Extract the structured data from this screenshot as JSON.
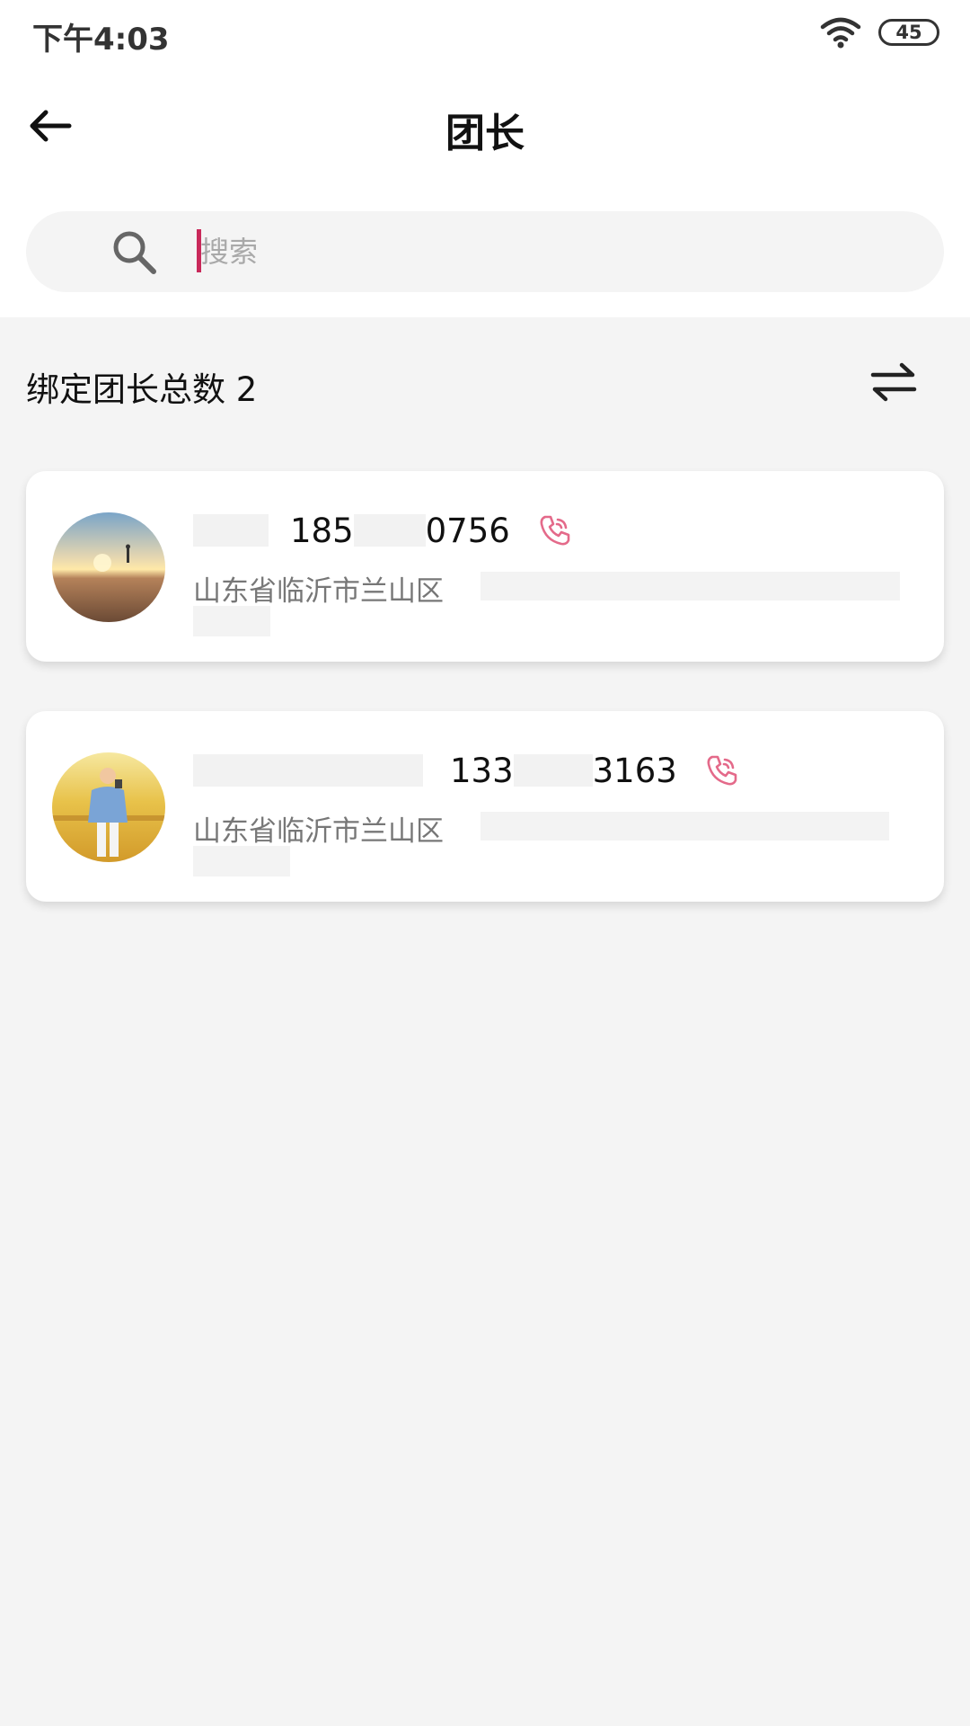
{
  "status_bar": {
    "time": "下午4:03",
    "battery": "45"
  },
  "header": {
    "title": "团长"
  },
  "search": {
    "placeholder": "搜索"
  },
  "summary": {
    "label": "绑定团长总数 2"
  },
  "leaders": [
    {
      "phone_prefix": "185",
      "phone_suffix": "0756",
      "address": "山东省临沂市兰山区"
    },
    {
      "phone_prefix": "133",
      "phone_suffix": "3163",
      "address": "山东省临沂市兰山区"
    }
  ],
  "colors": {
    "accent": "#c9295a",
    "phone_icon": "#e46a8a",
    "background": "#f4f4f4"
  }
}
